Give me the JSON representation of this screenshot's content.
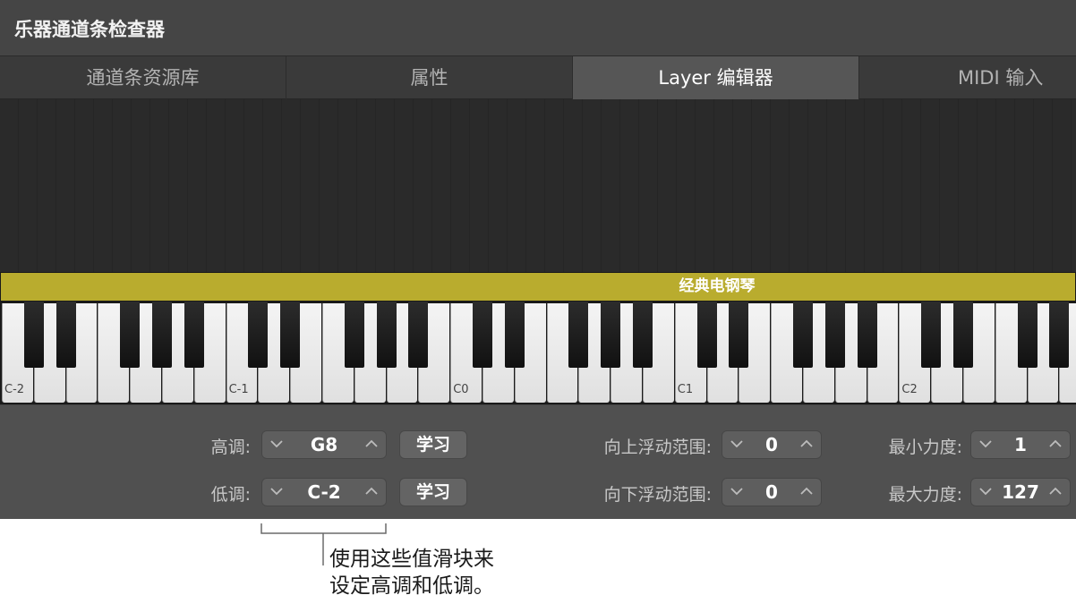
{
  "window": {
    "title": "乐器通道条检查器"
  },
  "tabs": [
    {
      "label": "通道条资源库",
      "active": false
    },
    {
      "label": "属性",
      "active": false
    },
    {
      "label": "Layer 编辑器",
      "active": true
    },
    {
      "label": "MIDI 输入",
      "active": false
    }
  ],
  "layer": {
    "name": "经典电钢琴",
    "color": "#b9ac2e"
  },
  "keyboard": {
    "octave_labels": [
      "C-2",
      "C-1",
      "C0",
      "C1",
      "C2"
    ]
  },
  "controls": {
    "high_key": {
      "label": "高调:",
      "value": "G8",
      "learn_label": "学习"
    },
    "low_key": {
      "label": "低调:",
      "value": "C-2",
      "learn_label": "学习"
    },
    "transpose_up": {
      "label": "向上浮动范围:",
      "value": "0"
    },
    "transpose_down": {
      "label": "向下浮动范围:",
      "value": "0"
    },
    "min_velocity": {
      "label": "最小力度:",
      "value": "1"
    },
    "max_velocity": {
      "label": "最大力度:",
      "value": "127"
    }
  },
  "callout": {
    "text": "使用这些值滑块来\n设定高调和低调。"
  }
}
